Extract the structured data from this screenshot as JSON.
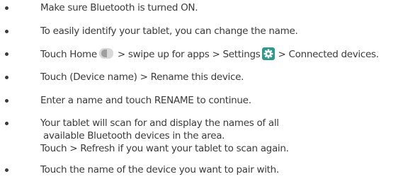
{
  "steps": [
    {
      "lines": [
        "Make sure Bluetooth is turned ON."
      ]
    },
    {
      "lines": [
        "To easily identify your tablet, you can change the name."
      ]
    },
    {
      "segments": {
        "before_home": "Touch Home",
        "after_home": "> swipe up for apps > Settings",
        "after_gear": "> Connected devices."
      },
      "icons": {
        "home": "home-toggle-icon",
        "settings": "settings-gear-icon"
      }
    },
    {
      "lines": [
        "Touch (Device name)  > Rename this device."
      ]
    },
    {
      "lines": [
        "Enter a name and touch RENAME to continue."
      ]
    },
    {
      "lines": [
        "Your tablet will scan for and display the names of all",
        "available Bluetooth devices in the area.",
        "Touch  > Refresh if you want your tablet to scan again."
      ]
    },
    {
      "lines": [
        "Touch the name of the device you want to pair with."
      ]
    }
  ],
  "colors": {
    "text": "#3a3a3a",
    "bullet": "#3a3a3a",
    "home_icon_light": "#d8d8d8",
    "home_icon_dark": "#9e9e9e",
    "settings_icon": "#2e9a8c"
  }
}
